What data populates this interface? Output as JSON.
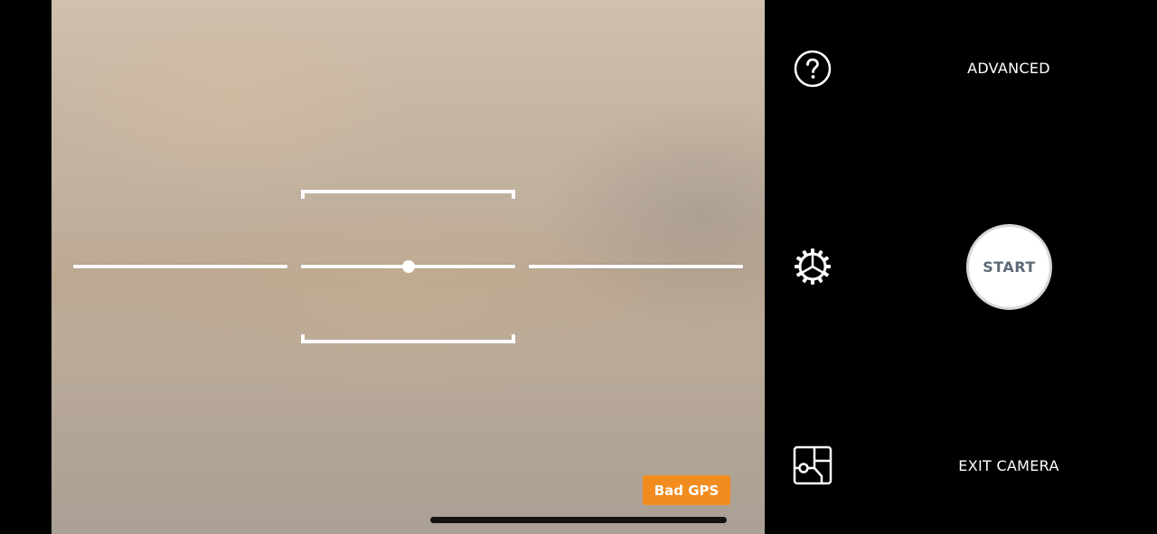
{
  "viewfinder": {
    "gps_badge": "Bad GPS",
    "badge_color": "#f28c1e"
  },
  "controls": {
    "help_icon": "question-circle-icon",
    "settings_icon": "gear-icon",
    "map_icon": "map-icon",
    "advanced_label": "ADVANCED",
    "start_label": "START",
    "exit_label": "EXIT CAMERA"
  }
}
